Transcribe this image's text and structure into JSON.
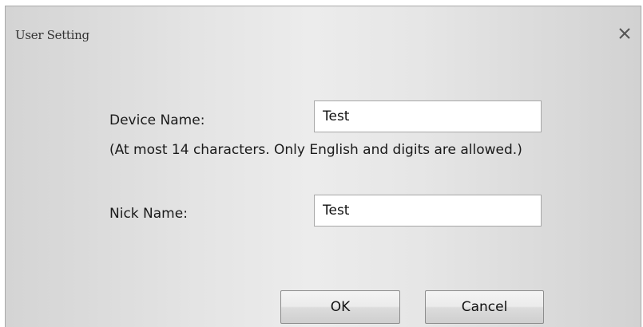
{
  "dialog": {
    "title": "User Setting",
    "close_icon": "close-icon"
  },
  "device_name": {
    "label": "Device Name:",
    "value": "Test",
    "hint": "(At most 14 characters. Only English and digits are allowed.)"
  },
  "nick_name": {
    "label": "Nick Name:",
    "value": "Test"
  },
  "buttons": {
    "ok_label": "OK",
    "cancel_label": "Cancel"
  }
}
